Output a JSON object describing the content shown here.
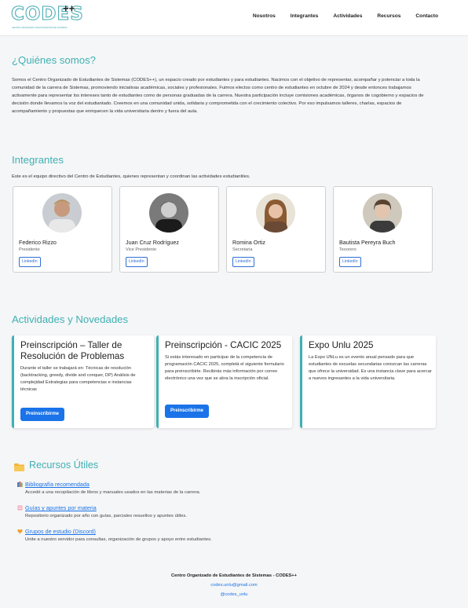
{
  "brand": {
    "logo_text": "CODES",
    "logo_plus": "++",
    "logo_sub": "CENTRO ORGANIZADO DE ESTUDIANTES DE SISTEMAS"
  },
  "nav": [
    "Nosotros",
    "Integrantes",
    "Actividades",
    "Recursos",
    "Contacto"
  ],
  "about": {
    "title": "¿Quiénes somos?",
    "text": "Somos el Centro Organizado de Estudiantes de Sistemas (CODES++), un espacio creado por estudiantes y para estudiantes. Nacimos con el objetivo de representar, acompañar y potenciar a toda la comunidad de la carrera de Sistemas, promoviendo iniciativas académicas, sociales y profesionales. Fuimos electos como centro de estudiantes en octubre de 2024 y desde entonces trabajamos activamente para representar los intereses tanto de estudiantes como de personas graduadas de la carrera. Nuestra participación incluye comisiones académicas, órganos de cogobierno y espacios de decisión donde llevamos la voz del estudiantado. Creemos en una comunidad unida, solidaria y comprometida con el crecimiento colectivo. Por eso impulsamos talleres, charlas, espacios de acompañamiento y propuestas que enriquecen la vida universitaria dentro y fuera del aula."
  },
  "team": {
    "title": "Integrantes",
    "intro": "Este es el equipo directivo del Centro de Estudiantes, quienes representan y coordinan las actividades estudiantiles.",
    "members": [
      {
        "name": "Federico Rizzo",
        "role": "Presidente",
        "link": "LinkedIn"
      },
      {
        "name": "Juan Cruz Rodríguez",
        "role": "Vice Presidente",
        "link": "LinkedIn"
      },
      {
        "name": "Romina Ortiz",
        "role": "Secretaria",
        "link": "LinkedIn"
      },
      {
        "name": "Bautista Pereyra Buch",
        "role": "Tesorero",
        "link": "LinkedIn"
      }
    ]
  },
  "activities": {
    "title": "Actividades y Novedades",
    "items": [
      {
        "title": "Preinscripción – Taller de Resolución de Problemas",
        "desc": "Durante el taller se trabajará en: Técnicas de resolución (backtracking, greedy, divide and conquer, DP) Análisis de complejidad Estrategias para competencias e instancias técnicas",
        "button": "Preinscribirme"
      },
      {
        "title": "Preinscripción - CACIC 2025",
        "desc": "Si estás interesado en participar de la competencia de programación CACIC 2025, completá el siguiente formulario para preinscribirte. Recibirás más información por correo electrónico una vez que se abra la inscripción oficial.",
        "button": "Preinscribirme"
      },
      {
        "title": "Expo Unlu 2025",
        "desc": "La Expo UNLu es un evento anual pensado para que estudiantes de escuelas secundarias conozcan las carreras que ofrece la universidad. Es una instancia clave para acercar a nuevos ingresantes a la vida universitaria.",
        "button": ""
      }
    ]
  },
  "resources": {
    "title": "Recursos Útiles",
    "items": [
      {
        "label": "Bibliografía recomendada",
        "desc": "Accedé a una recopilación de libros y manuales usados en las materias de la carrera.",
        "icon": "books-icon"
      },
      {
        "label": "Guías y apuntes por materia",
        "desc": "Repositorio organizado por año con guías, parciales resueltos y apuntes útiles.",
        "icon": "notes-icon"
      },
      {
        "label": "Grupos de estudio (Discord)",
        "desc": "Unite a nuestro servidor para consultas, organización de grupos y apoyo entre estudiantes.",
        "icon": "heart-icon"
      }
    ]
  },
  "footer": {
    "org": "Centro Organizado de Estudiantes de Sistemas - CODES++",
    "email": "codes.unlu@gmail.com",
    "instagram": "@codes_unlu"
  },
  "colors": {
    "accent": "#3fb0b4",
    "primary": "#1a73e8",
    "link": "#1a73e8"
  }
}
